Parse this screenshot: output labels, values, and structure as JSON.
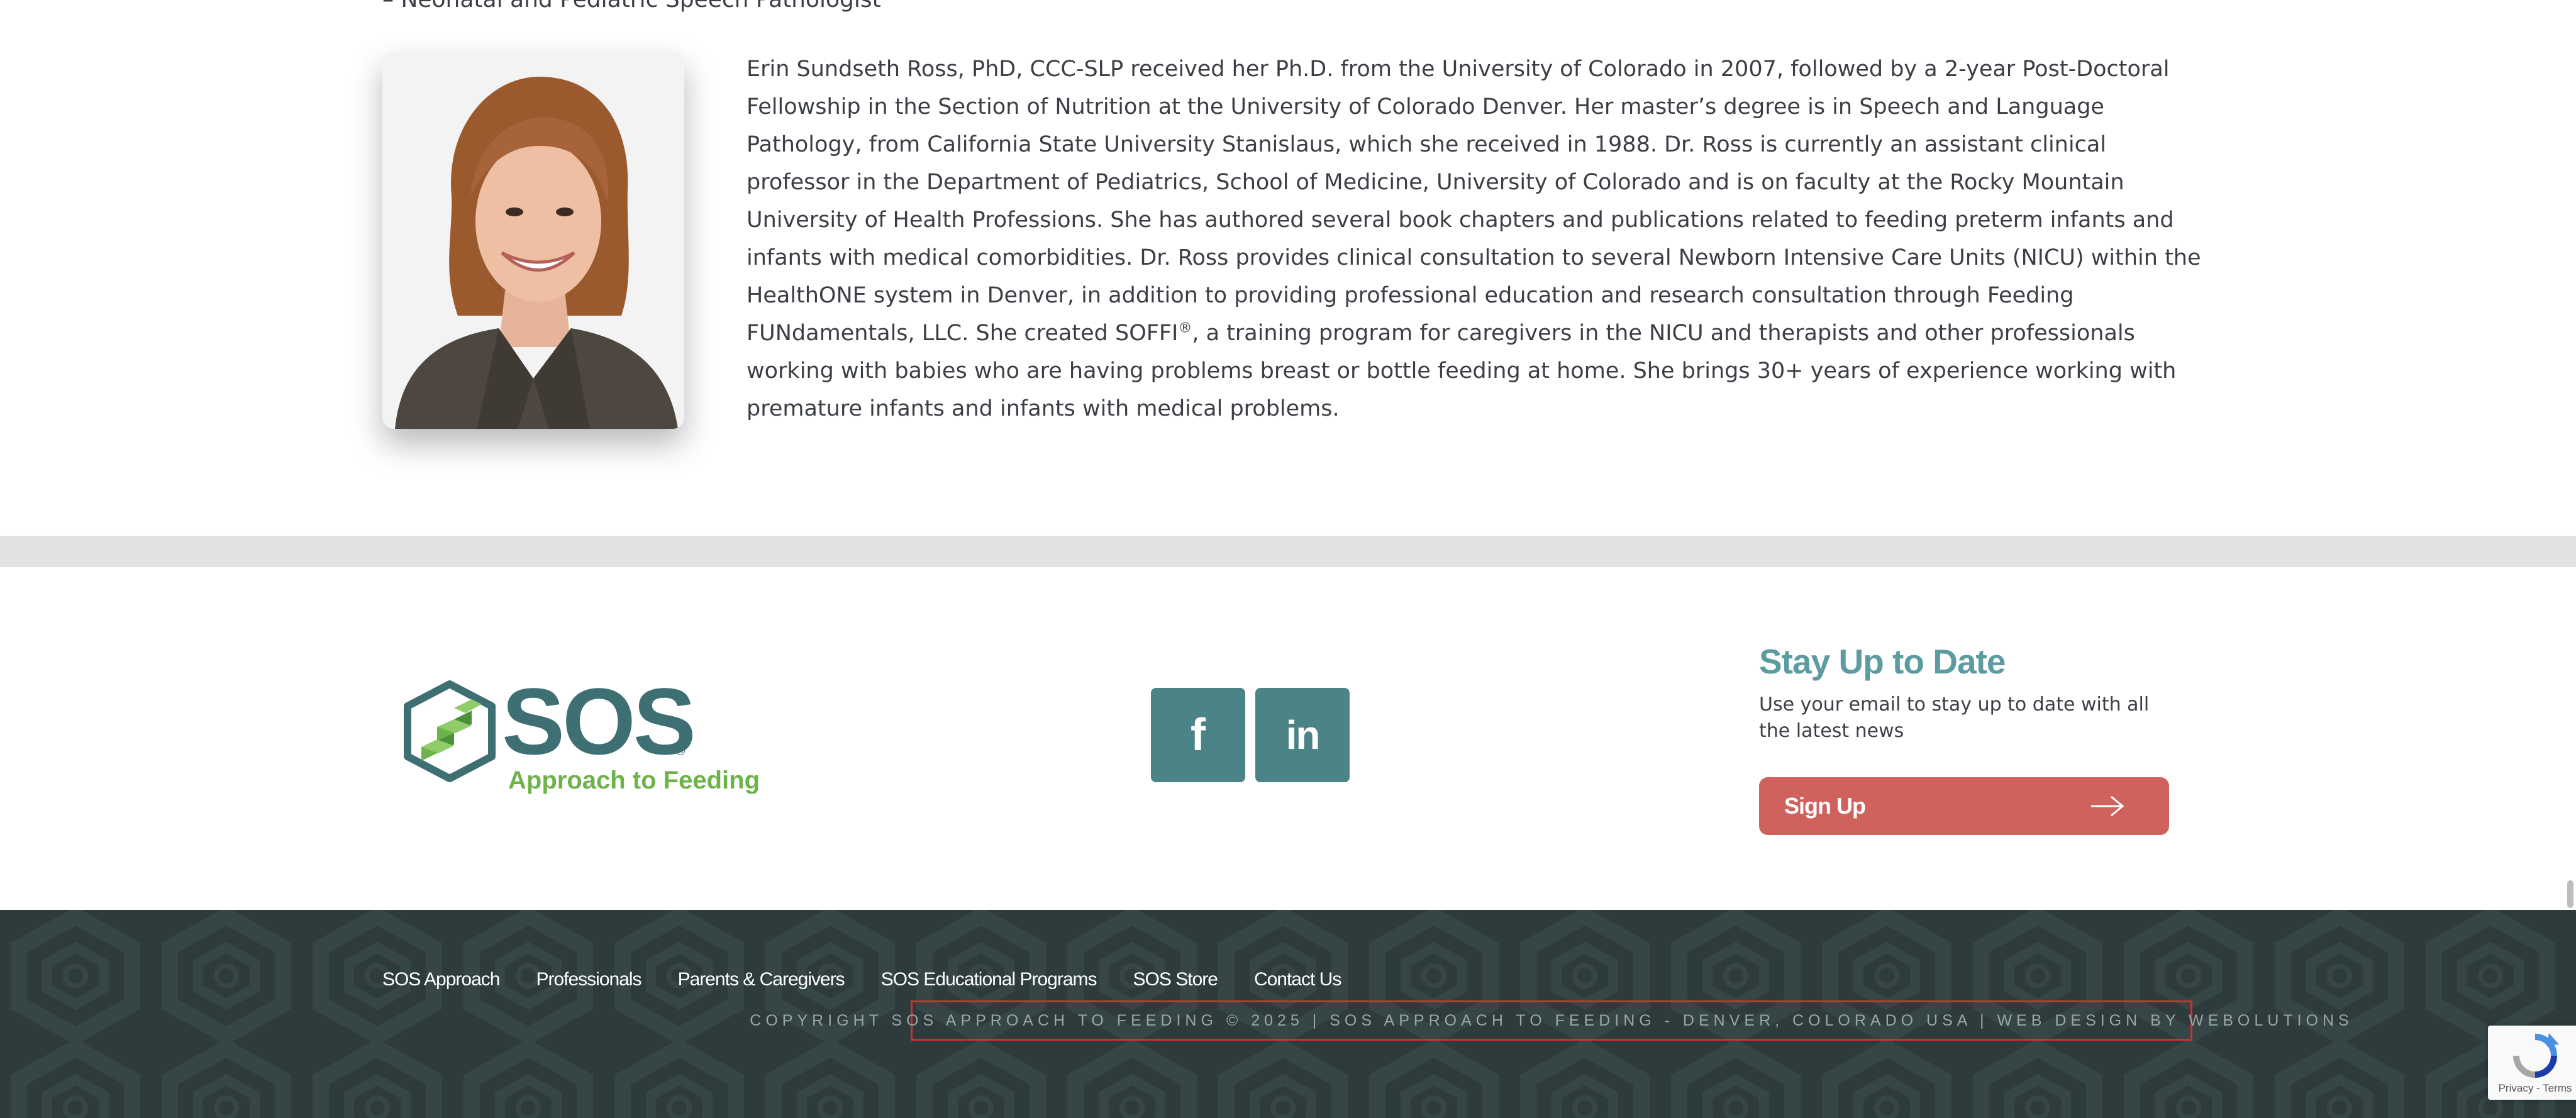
{
  "bio": {
    "role_line": "– Neonatal and Pediatric Speech Pathologist",
    "paragraph_main": "Erin Sundseth Ross, PhD, CCC-SLP received her Ph.D. from the University of Colorado in 2007, followed by a 2-year Post-Doctoral Fellowship in the Section of Nutrition at the University of Colorado Denver. Her master’s degree is in Speech and Language Pathology, from California State University Stanislaus, which she received in 1988. Dr. Ross is currently an assistant clinical professor in the Department of Pediatrics, School of Medicine, University of Colorado and is on faculty at the Rocky Mountain University of Health Professions. She has authored several book chapters and publications related to feeding preterm infants and infants with medical comorbidities. Dr. Ross provides clinical consultation to several Newborn Intensive Care Units (NICU) within the HealthONE system in Denver, in addition to providing professional education and research consultation through Feeding FUNdamentals, LLC. She created SOFFI",
    "registered_mark": "®",
    "paragraph_tail": ", a training program for caregivers in the NICU and therapists and other professionals working with babies who are having problems breast or bottle feeding at home. She brings 30+ years of experience working with premature infants and infants with medical problems."
  },
  "footer": {
    "logo": {
      "wordmark": "SOS",
      "tagline": "Approach to Feeding",
      "registered": "®"
    },
    "social": [
      {
        "name": "facebook",
        "glyph": "f"
      },
      {
        "name": "linkedin",
        "glyph": "in"
      }
    ],
    "newsletter": {
      "title": "Stay Up to Date",
      "description": "Use your email to stay up to date with all the latest news",
      "button_label": "Sign Up"
    },
    "nav": [
      {
        "label": "SOS Approach"
      },
      {
        "label": "Professionals"
      },
      {
        "label": "Parents & Caregivers"
      },
      {
        "label": "SOS Educational Programs"
      },
      {
        "label": "SOS Store"
      },
      {
        "label": "Contact Us"
      }
    ],
    "copyright": "COPYRIGHT SOS APPROACH TO FEEDING © 2025 | SOS APPROACH TO FEEDING - DENVER, COLORADO USA | WEB DESIGN BY WEBOLUTIONS"
  },
  "recaptcha": {
    "links": "Privacy - Terms"
  },
  "colors": {
    "brand_teal": "#4b8386",
    "heading_teal": "#5c9ca1",
    "logo_green": "#6db34a",
    "signup_red": "#d0625e",
    "footer_dark": "#2d3b3c",
    "highlight_outline": "#d32f2f"
  }
}
